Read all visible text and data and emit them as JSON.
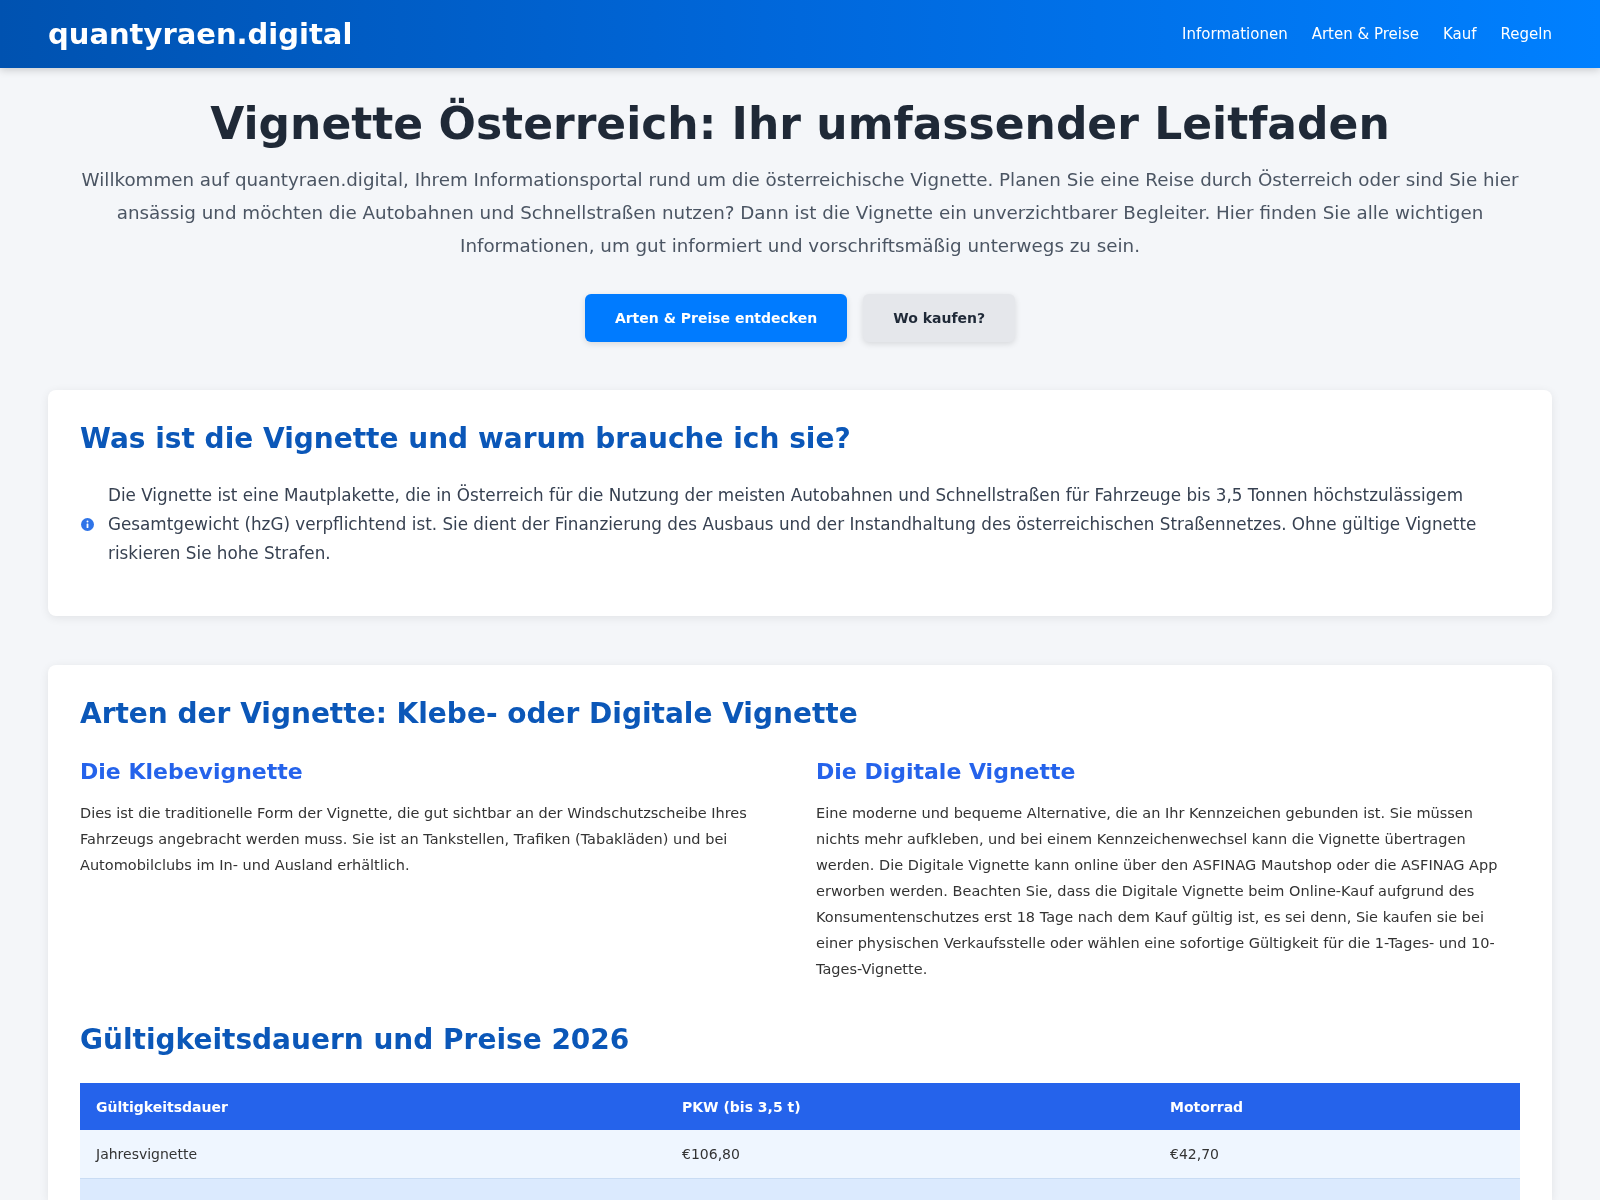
{
  "header": {
    "logo": "quantyraen.digital",
    "nav": [
      {
        "label": "Informationen"
      },
      {
        "label": "Arten & Preise"
      },
      {
        "label": "Kauf"
      },
      {
        "label": "Regeln"
      }
    ]
  },
  "hero": {
    "title": "Vignette Österreich: Ihr umfassender Leitfaden",
    "intro": "Willkommen auf quantyraen.digital, Ihrem Informationsportal rund um die österreichische Vignette. Planen Sie eine Reise durch Österreich oder sind Sie hier ansässig und möchten die Autobahnen und Schnellstraßen nutzen? Dann ist die Vignette ein unverzichtbarer Begleiter. Hier finden Sie alle wichtigen Informationen, um gut informiert und vorschriftsmäßig unterwegs zu sein.",
    "buttons": [
      {
        "label": "Arten & Preise entdecken",
        "kind": "primary"
      },
      {
        "label": "Wo kaufen?",
        "kind": "secondary"
      }
    ]
  },
  "info_section": {
    "title": "Was ist die Vignette und warum brauche ich sie?",
    "note": "Die Vignette ist eine Mautplakette, die in Österreich für die Nutzung der meisten Autobahnen und Schnellstraßen für Fahrzeuge bis 3,5 Tonnen höchstzulässigem Gesamtgewicht (hzG) verpflichtend ist. Sie dient der Finanzierung des Ausbaus und der Instandhaltung des österreichischen Straßennetzes. Ohne gültige Vignette riskieren Sie hohe Strafen."
  },
  "types_section": {
    "title": "Arten der Vignette: Klebe- oder Digitale Vignette",
    "columns": [
      {
        "title": "Die Klebevignette",
        "text": "Dies ist die traditionelle Form der Vignette, die gut sichtbar an der Windschutzscheibe Ihres Fahrzeugs angebracht werden muss. Sie ist an Tankstellen, Trafiken (Tabakläden) und bei Automobilclubs im In- und Ausland erhältlich."
      },
      {
        "title": "Die Digitale Vignette",
        "text": "Eine moderne und bequeme Alternative, die an Ihr Kennzeichen gebunden ist. Sie müssen nichts mehr aufkleben, und bei einem Kennzeichenwechsel kann die Vignette übertragen werden. Die Digitale Vignette kann online über den ASFINAG Mautshop oder die ASFINAG App erworben werden. Beachten Sie, dass die Digitale Vignette beim Online-Kauf aufgrund des Konsumentenschutzes erst 18 Tage nach dem Kauf gültig ist, es sei denn, Sie kaufen sie bei einer physischen Verkaufsstelle oder wählen eine sofortige Gültigkeit für die 1-Tages- und 10-Tages-Vignette."
      }
    ],
    "prices_title": "Gültigkeitsdauern und Preise 2026",
    "table": {
      "columns": [
        "Gültigkeitsdauer",
        "PKW (bis 3,5 t)",
        "Motorrad"
      ],
      "rows": [
        [
          "Jahresvignette",
          "€106,80",
          "€42,70"
        ]
      ]
    }
  }
}
